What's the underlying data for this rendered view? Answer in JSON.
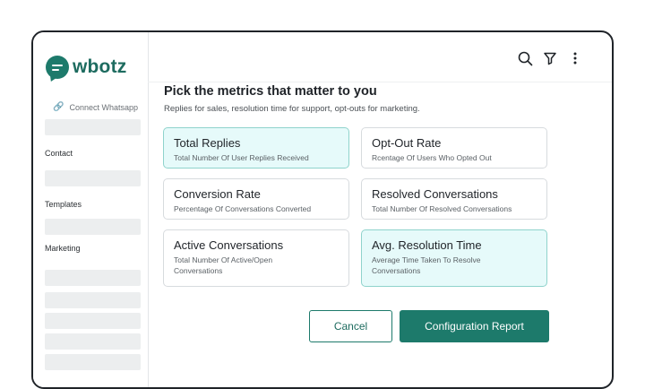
{
  "brand": {
    "name": "wbotz",
    "color": "#1d7a6b"
  },
  "sidebar": {
    "connect_label": "Connect Whatsapp",
    "items": [
      {
        "label": "Contact"
      },
      {
        "label": "Templates"
      },
      {
        "label": "Marketing"
      }
    ]
  },
  "header": {
    "icons": [
      "search-icon",
      "filter-icon",
      "more-vertical-icon"
    ]
  },
  "main": {
    "title": "Pick the metrics that matter to you",
    "subtitle": "Replies for sales, resolution time for support, opt-outs for marketing.",
    "metrics": [
      {
        "title": "Total Replies",
        "desc": "Total Number Of User Replies Received",
        "selected": true
      },
      {
        "title": "Opt-Out Rate",
        "desc": "Rcentage Of Users Who Opted Out",
        "selected": false
      },
      {
        "title": "Conversion Rate",
        "desc": "Percentage Of Conversations Converted",
        "selected": false
      },
      {
        "title": "Resolved Conversations",
        "desc": "Total Number Of Resolved Conversations",
        "selected": false
      },
      {
        "title": "Active Conversations",
        "desc": "Total Number Of Active/Open Conversations",
        "selected": false
      },
      {
        "title": "Avg. Resolution Time",
        "desc": "Average Time Taken To Resolve Conversations",
        "selected": true
      }
    ],
    "cancel_label": "Cancel",
    "config_label": "Configuration Report"
  }
}
